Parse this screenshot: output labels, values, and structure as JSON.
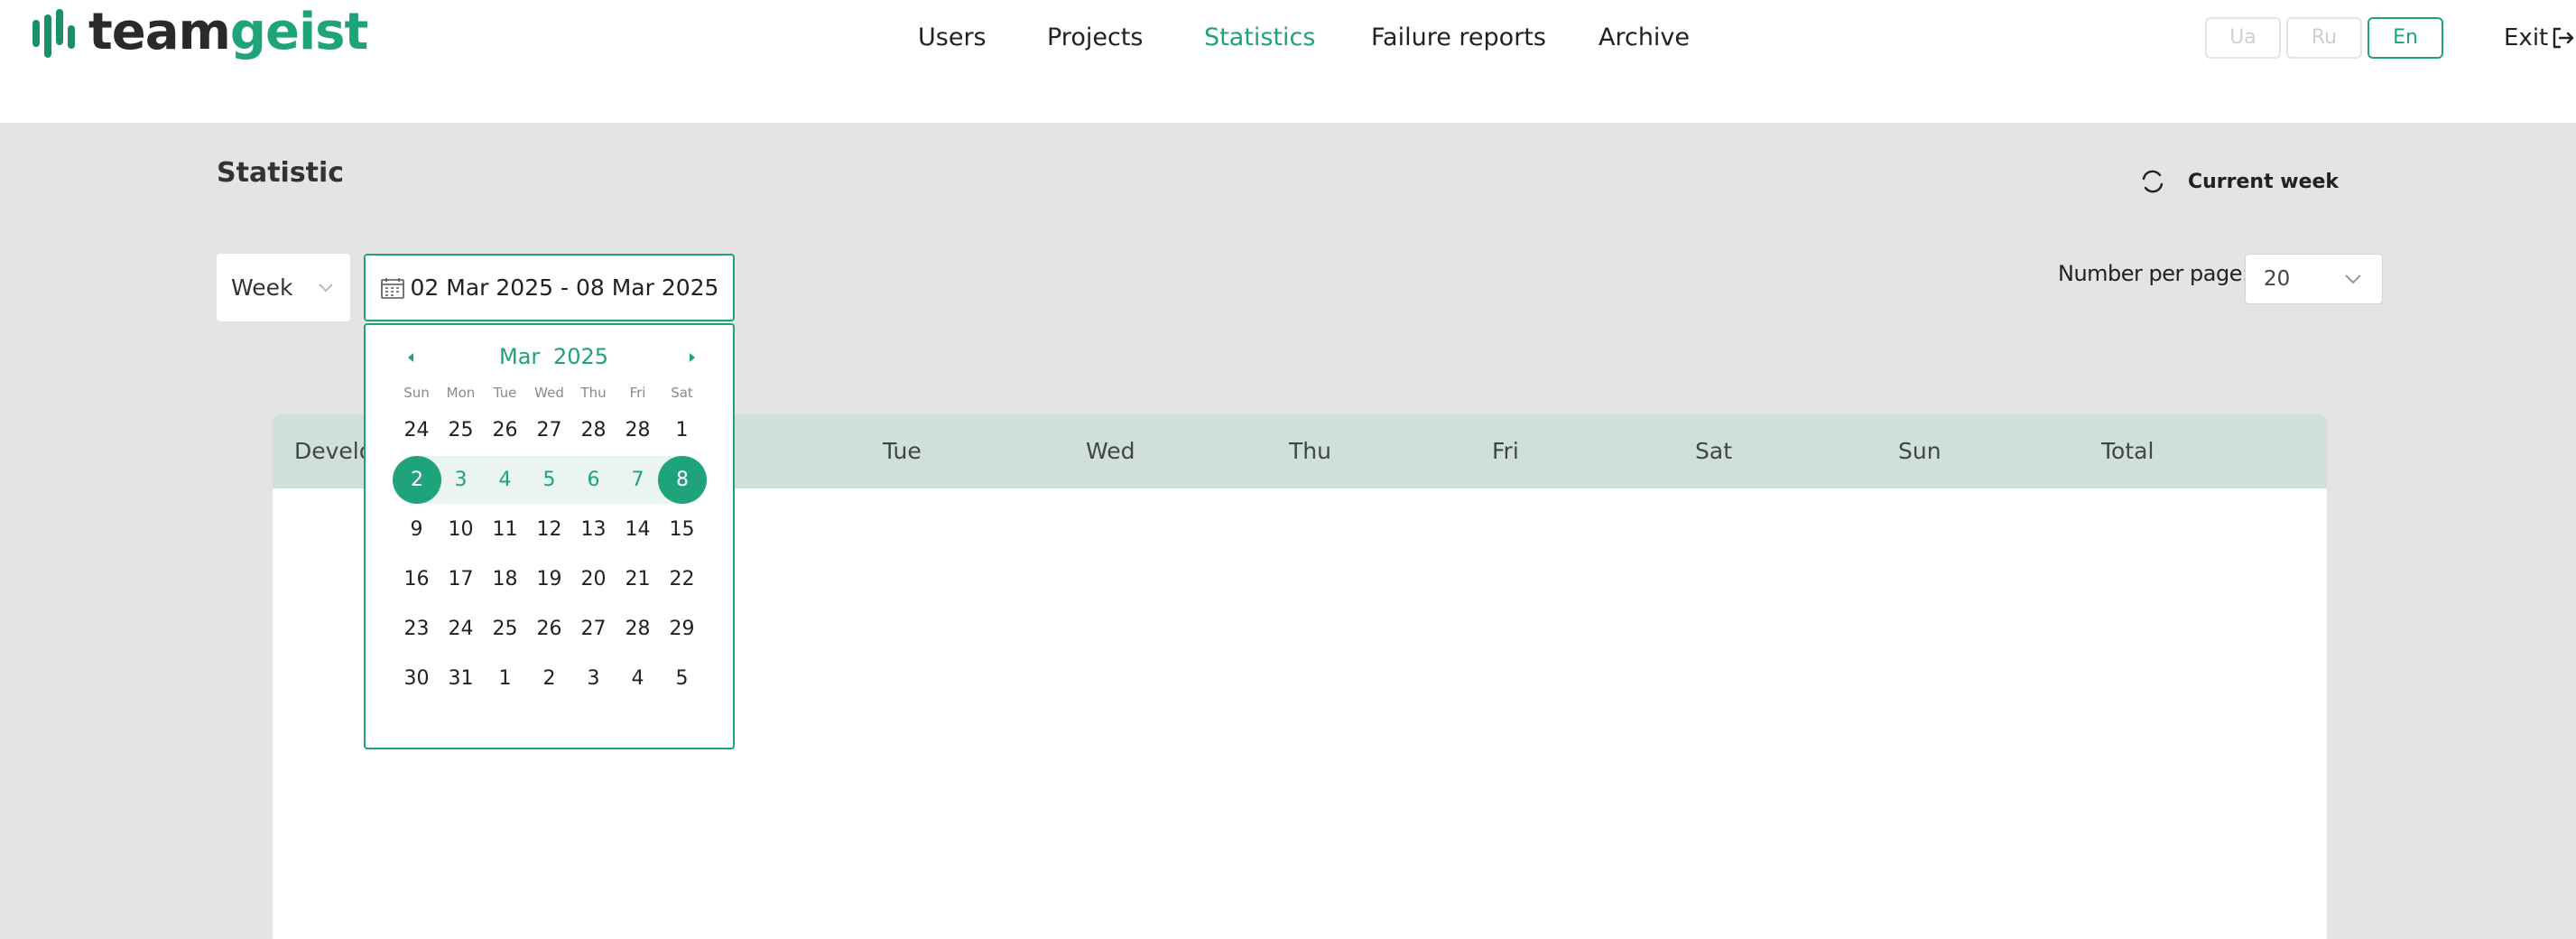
{
  "brand": {
    "part1": "team",
    "part2": "geist"
  },
  "nav": [
    {
      "label": "Users",
      "active": false
    },
    {
      "label": "Projects",
      "active": false
    },
    {
      "label": "Statistics",
      "active": true
    },
    {
      "label": "Failure reports",
      "active": false
    },
    {
      "label": "Archive",
      "active": false
    }
  ],
  "languages": [
    {
      "label": "Ua",
      "active": false
    },
    {
      "label": "Ru",
      "active": false
    },
    {
      "label": "En",
      "active": true
    }
  ],
  "exit_label": "Exit",
  "page": {
    "title": "Statistic",
    "current_week_label": "Current week",
    "period_select": "Week",
    "date_range": "02 Mar 2025 - 08 Mar 2025",
    "number_per_page_label": "Number per page:",
    "number_per_page_value": "20"
  },
  "table": {
    "headers": [
      "Develo",
      "Tue",
      "Wed",
      "Thu",
      "Fri",
      "Sat",
      "Sun",
      "Total"
    ]
  },
  "calendar": {
    "month": "Mar",
    "year": "2025",
    "weekdays": [
      "Sun",
      "Mon",
      "Tue",
      "Wed",
      "Thu",
      "Fri",
      "Sat"
    ],
    "weeks": [
      [
        "24",
        "25",
        "26",
        "27",
        "28",
        "28",
        "1"
      ],
      [
        "2",
        "3",
        "4",
        "5",
        "6",
        "7",
        "8"
      ],
      [
        "9",
        "10",
        "11",
        "12",
        "13",
        "14",
        "15"
      ],
      [
        "16",
        "17",
        "18",
        "19",
        "20",
        "21",
        "22"
      ],
      [
        "23",
        "24",
        "25",
        "26",
        "27",
        "28",
        "29"
      ],
      [
        "30",
        "31",
        "1",
        "2",
        "3",
        "4",
        "5"
      ]
    ],
    "selected_week_row": 1
  },
  "colors": {
    "accent": "#1fa37a",
    "range_band": "#eaf5f0",
    "table_header": "#cfe0d9",
    "page_bg": "#e4e4e4"
  }
}
